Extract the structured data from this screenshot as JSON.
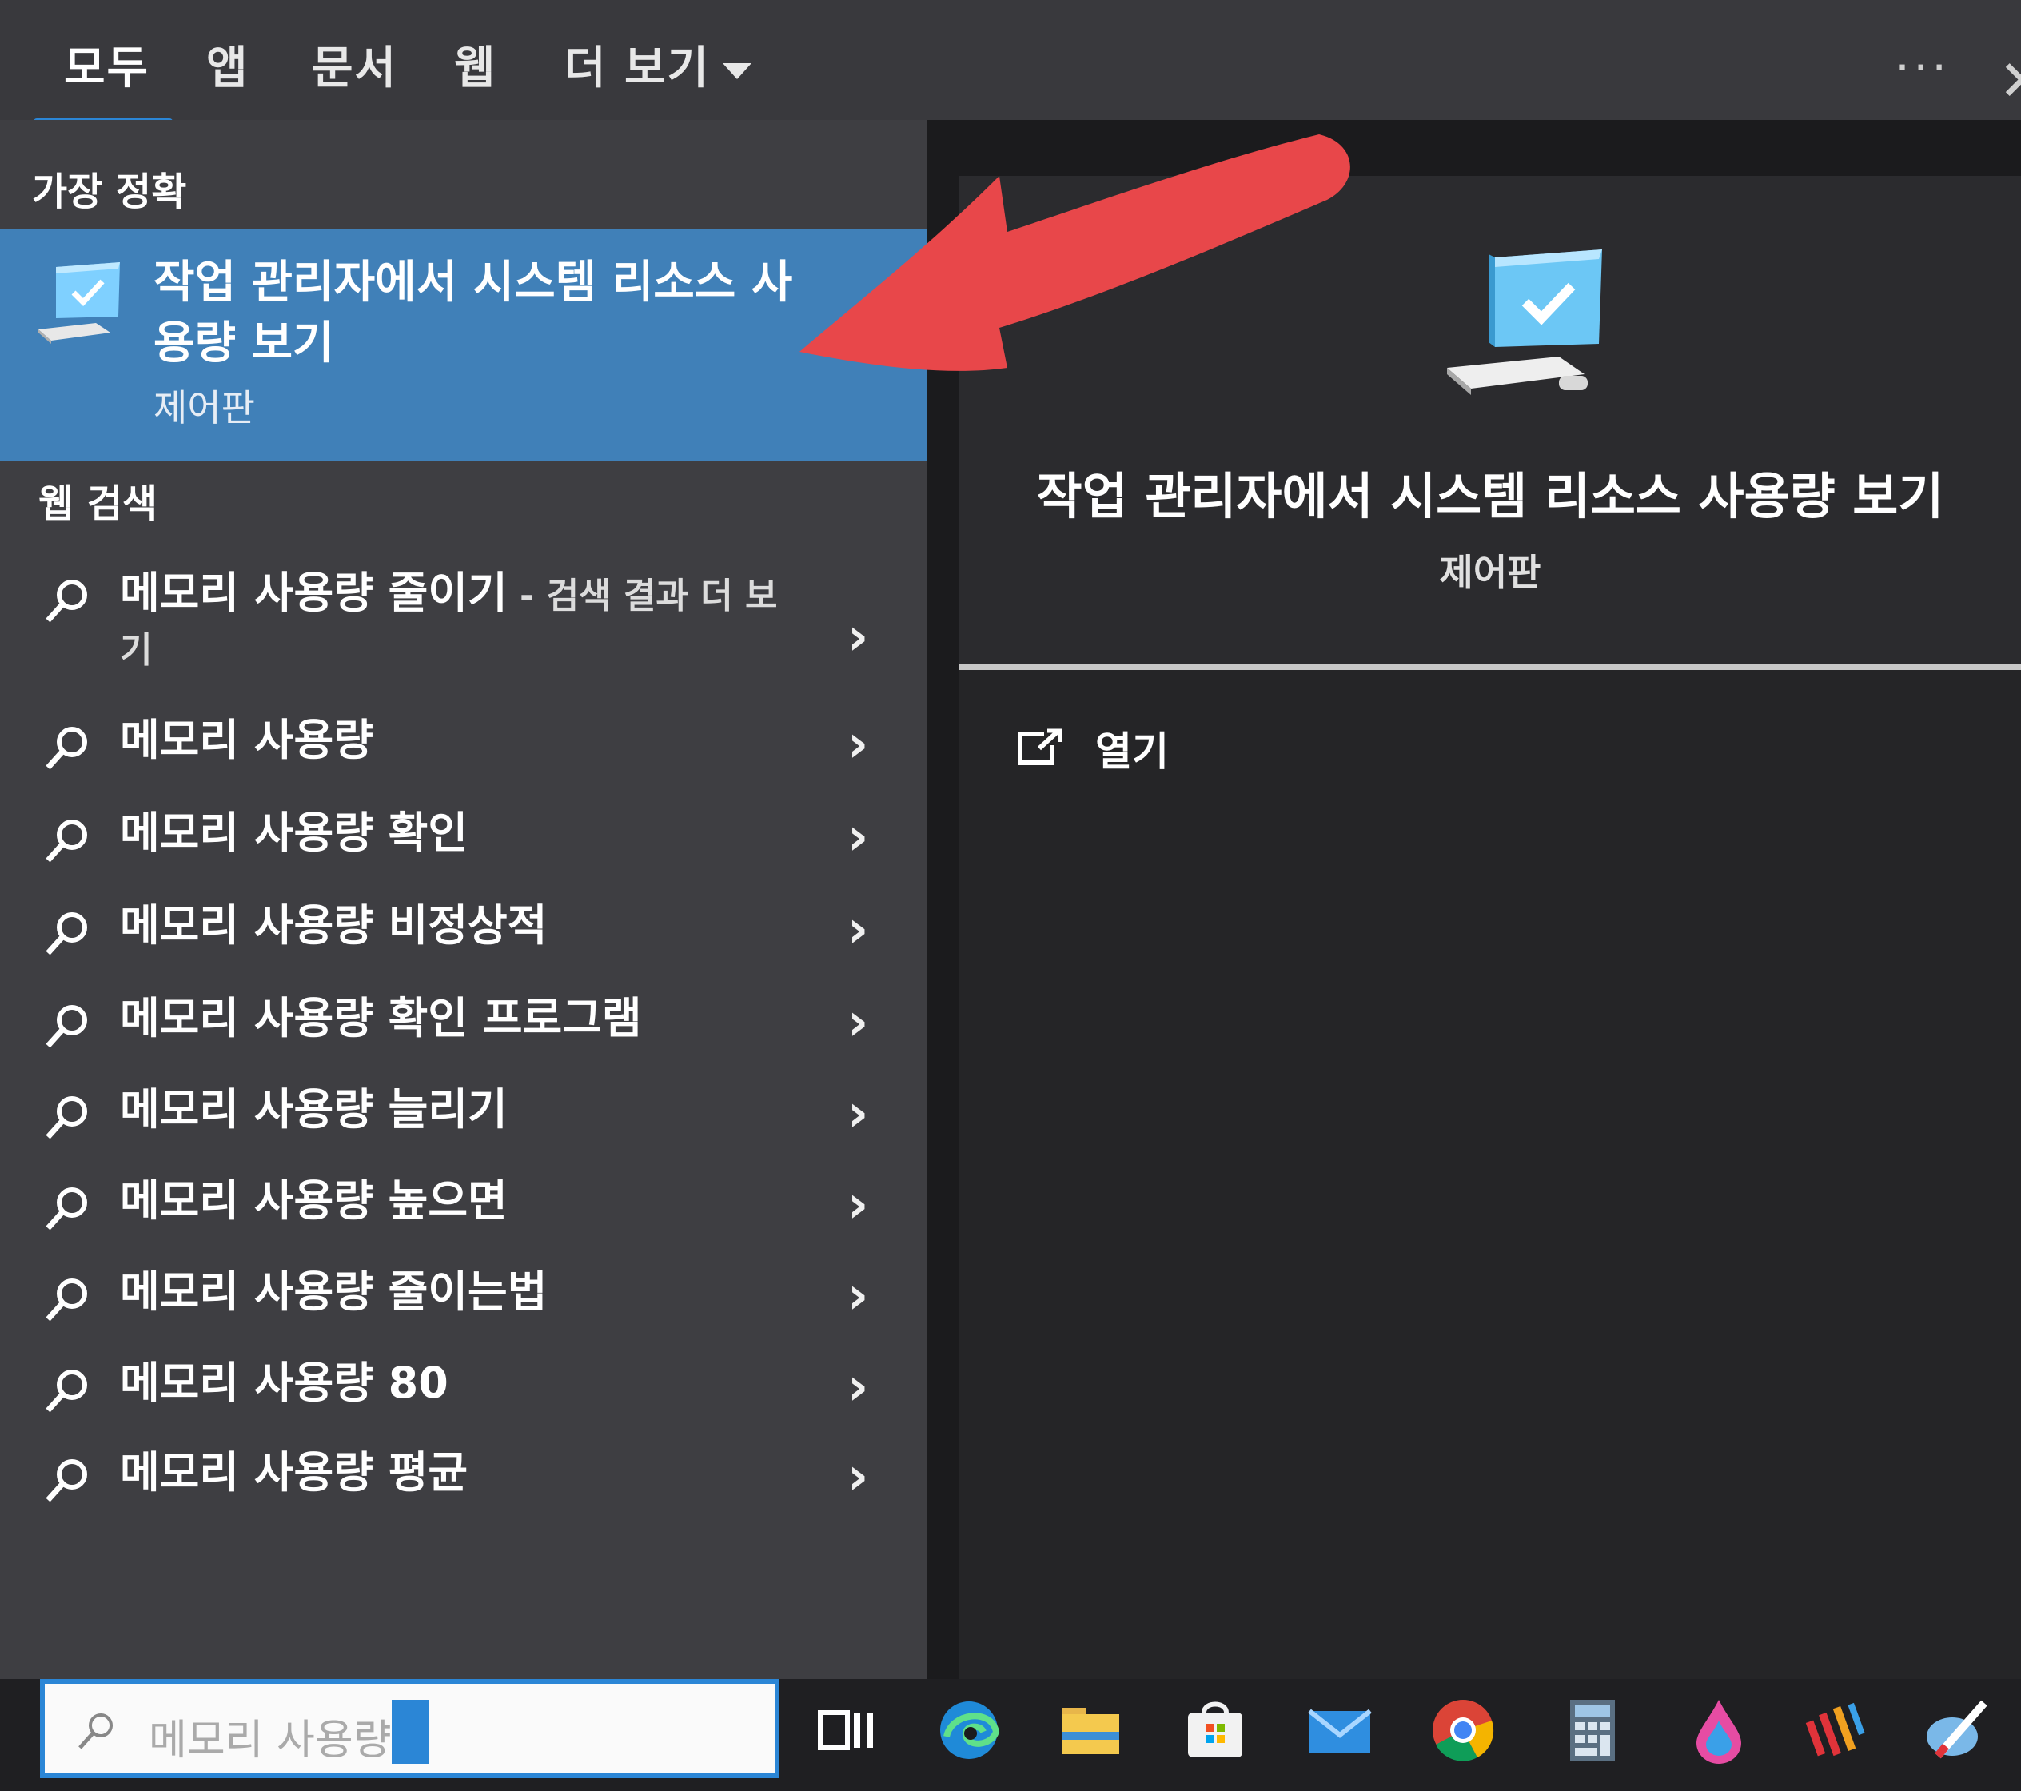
{
  "tabs": [
    {
      "label": "모두"
    },
    {
      "label": "앱"
    },
    {
      "label": "문서"
    },
    {
      "label": "웹"
    },
    {
      "label": "더 보기"
    }
  ],
  "top_actions": {
    "more": "···",
    "close": "✕"
  },
  "best_match": {
    "heading": "가장 정확",
    "title": "작업 관리자에서 시스템 리소스 사용량 보기",
    "subtitle": "제어판"
  },
  "web_search": {
    "heading": "웹 검색",
    "results": [
      {
        "text": "메모리 사용량 줄이기",
        "suffix": " - 검색 결과 더 보기"
      },
      {
        "text": "메모리 사용량"
      },
      {
        "text": "메모리 사용량 확인"
      },
      {
        "text": "메모리 사용량 비정상적"
      },
      {
        "text": "메모리 사용량 확인 프로그램"
      },
      {
        "text": "메모리 사용량 늘리기"
      },
      {
        "text": "메모리 사용량 높으면"
      },
      {
        "text": "메모리 사용량 줄이는법"
      },
      {
        "text": "메모리 사용량 80"
      },
      {
        "text": "메모리 사용량 평균"
      }
    ]
  },
  "detail": {
    "title": "작업 관리자에서 시스템 리소스 사용량 보기",
    "subtitle": "제어판",
    "actions": [
      {
        "label": "열기",
        "icon": "open-icon"
      }
    ]
  },
  "search_box": {
    "value": "메모리 사용량"
  },
  "taskbar_icons": [
    "task-view-icon",
    "edge-icon",
    "file-explorer-icon",
    "store-icon",
    "mail-icon",
    "chrome-icon",
    "calculator-icon",
    "paint-3d-icon",
    "app-bars-icon",
    "pen-app-icon"
  ],
  "colors": {
    "accent": "#2b86d6",
    "best_match_bg": "#4080b8",
    "left_panel_bg": "#3e3e42",
    "right_panel_bg": "#252527",
    "annotation": "#e8474a"
  }
}
